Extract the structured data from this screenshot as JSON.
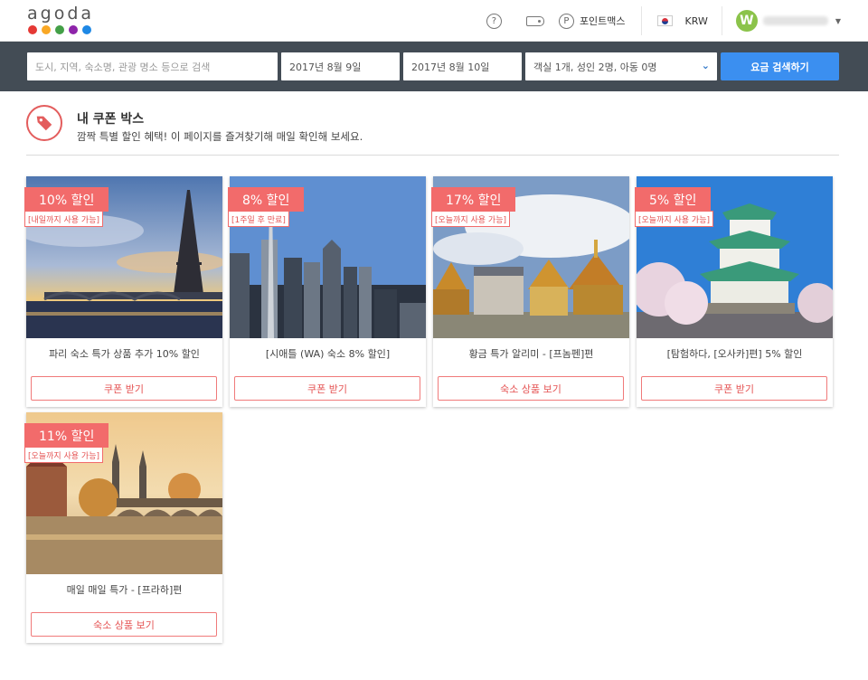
{
  "header": {
    "logo_text": "agoda",
    "logo_dot_colors": [
      "#e53935",
      "#f9a825",
      "#43a047",
      "#8e24aa",
      "#1e88e5"
    ],
    "help_icon": "question-circle-icon",
    "coupon_icon": "tag-icon",
    "points_icon": "p-circle-icon",
    "points_label": "포인트맥스",
    "currency": "KRW",
    "avatar_letter": "W"
  },
  "search": {
    "destination_placeholder": "도시, 지역, 숙소명, 관광 명소 등으로 검색",
    "checkin": "2017년 8월 9일",
    "checkout": "2017년 8월 10일",
    "guests": "객실 1개, 성인 2명, 아동 0명",
    "search_button": "요금 검색하기"
  },
  "coupon_box": {
    "title": "내 쿠폰 박스",
    "subtitle": "깜짝 특별 할인 혜택! 이 페이지를 즐겨찾기해 매일 확인해 보세요."
  },
  "coupons": [
    {
      "discount": "10% 할인",
      "note": "[내일까지 사용 가능]",
      "title": "파리 숙소 특가 상품 추가 10% 할인",
      "button": "쿠폰 받기"
    },
    {
      "discount": "8% 할인",
      "note": "[1주일 후 만료]",
      "title": "[시애틀 (WA) 숙소 8% 할인]",
      "button": "쿠폰 받기"
    },
    {
      "discount": "17% 할인",
      "note": "[오늘까지 사용 가능]",
      "title": "황금 특가 알리미 - [프놈펜]편",
      "button": "숙소 상품 보기"
    },
    {
      "discount": "5% 할인",
      "note": "[오늘까지 사용 가능]",
      "title": "[탐험하다, [오사카]편] 5% 할인",
      "button": "쿠폰 받기"
    },
    {
      "discount": "11% 할인",
      "note": "[오늘까지 사용 가능]",
      "title": "매일 매일 특가 - [프라하]편",
      "button": "숙소 상품 보기"
    }
  ]
}
